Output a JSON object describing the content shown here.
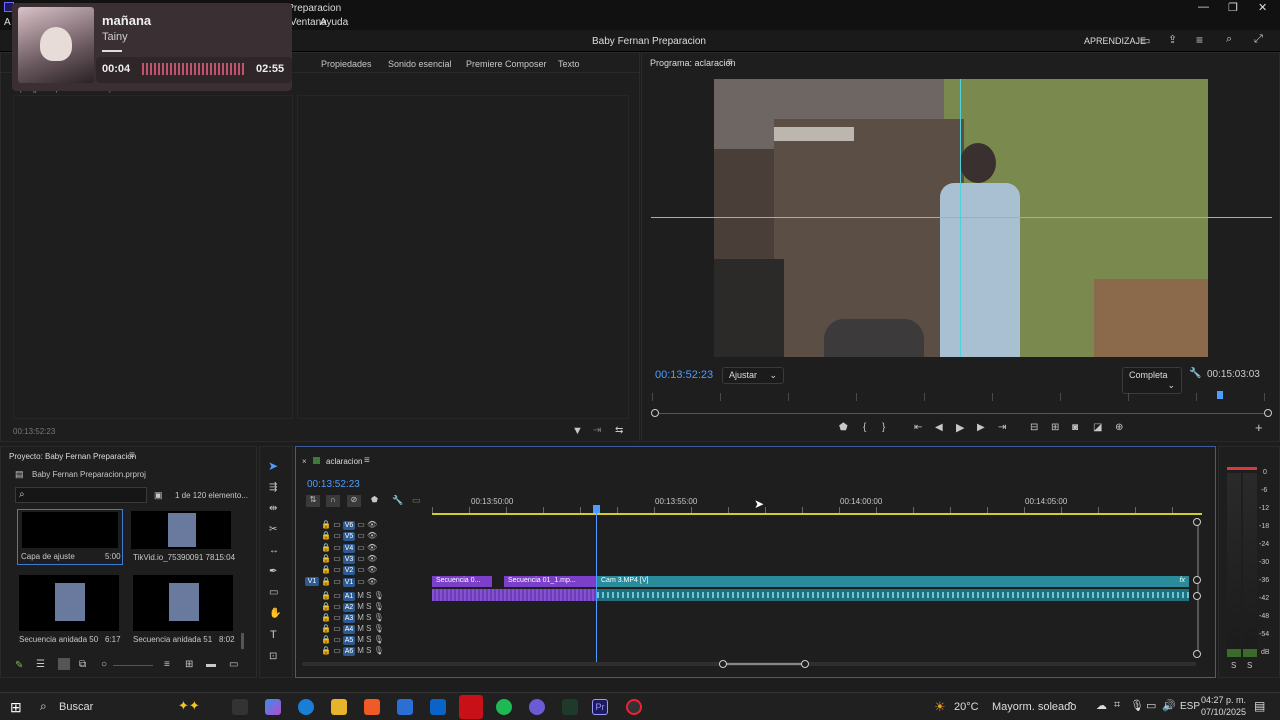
{
  "window": {
    "title_path": "...\\2025\\...\\Premiere Pro\\25.0\\Baby Fernan Preparacion",
    "controls": [
      "—",
      "❐",
      "✕"
    ]
  },
  "menu": [
    "Ventana",
    "Ayuda"
  ],
  "appbar": {
    "title": "Baby Fernan Preparacion",
    "learn_label": "APRENDIZAJE"
  },
  "media_overlay": {
    "song": "mañana",
    "artist": "Tainy",
    "elapsed": "00:04",
    "total": "02:55"
  },
  "source_panel": {
    "tabs": [
      "Propiedades",
      "Sonido esencial",
      "Premiere Composer",
      "Texto"
    ],
    "no_clip": "(ningún clip seleccionado)",
    "timecode": "00:13:52:23"
  },
  "program": {
    "tab_title": "Programa: aclaracion",
    "timecode": "00:13:52:23",
    "fit": "Ajustar",
    "quality": "Completa",
    "duration": "00:15:03:03"
  },
  "project": {
    "title": "Proyecto: Baby Fernan Preparacion",
    "file": "Baby Fernan Preparacion.prproj",
    "count": "1 de 120 elemento...",
    "items": [
      {
        "name": "Capa de ajuste",
        "duration": "5:00"
      },
      {
        "name": "TikVid.io_75390091 78...",
        "duration": "15:04"
      },
      {
        "name": "Secuencia anidada 50",
        "duration": "6:17"
      },
      {
        "name": "Secuencia anidada 51",
        "duration": "8:02"
      }
    ]
  },
  "timeline": {
    "tab": "aclaracion",
    "timecode": "00:13:52:23",
    "ruler": [
      "00:13:50:00",
      "00:13:55:00",
      "00:14:00:00",
      "00:14:05:00"
    ],
    "video_tracks": [
      "V6",
      "V5",
      "V4",
      "V3",
      "V2",
      "V1"
    ],
    "audio_tracks": [
      "A1",
      "A2",
      "A3",
      "A4",
      "A5",
      "A6"
    ],
    "clips": [
      {
        "name": "Secuencia 0...",
        "color": "#7b3fc9"
      },
      {
        "name": "Secuencia 01_1.mp...",
        "color": "#7b3fc9"
      },
      {
        "name": "Cam 3.MP4 [V]",
        "color": "#2a8c9b"
      }
    ]
  },
  "meter": {
    "scale": [
      "0",
      "-6",
      "-12",
      "-18",
      "-24",
      "-30",
      "-36",
      "-42",
      "-48",
      "-54",
      "dB"
    ],
    "solo": [
      "S",
      "S"
    ]
  },
  "taskbar": {
    "search": "Buscar",
    "weather_temp": "20°C",
    "weather_desc": "Mayorm. soleado",
    "lang": "ESP",
    "time": "04:27 p. m.",
    "date": "07/10/2025"
  }
}
